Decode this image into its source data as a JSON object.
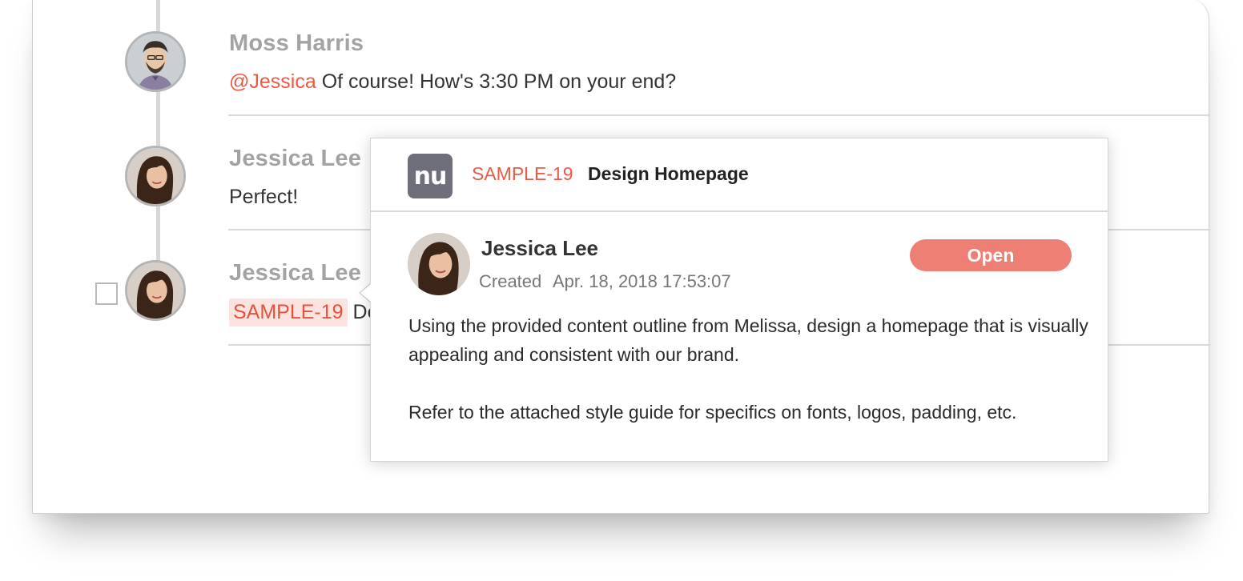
{
  "thread": {
    "messages": [
      {
        "author": "Moss Harris",
        "mention": "@Jessica",
        "text": " Of course! How's 3:30 PM on your end?"
      },
      {
        "author": "Jessica Lee",
        "text": "Perfect!"
      },
      {
        "author": "Jessica Lee",
        "tag": "SAMPLE-19",
        "text": " De"
      }
    ]
  },
  "card": {
    "logo_text": "nu",
    "issue_key": "SAMPLE-19",
    "issue_title": "Design Homepage",
    "author": "Jessica Lee",
    "created_label": "Created",
    "created_value": "Apr. 18, 2018 17:53:07",
    "status": "Open",
    "description": [
      "Using the provided content outline from Melissa, design a homepage that is visually appealing and consistent with our brand.",
      "Refer to the attached style guide for specifics on fonts, logos, padding, etc."
    ]
  },
  "colors": {
    "accent": "#ea5a44",
    "status_open": "#ee7f74",
    "logo_bg": "#6f6f7c"
  }
}
